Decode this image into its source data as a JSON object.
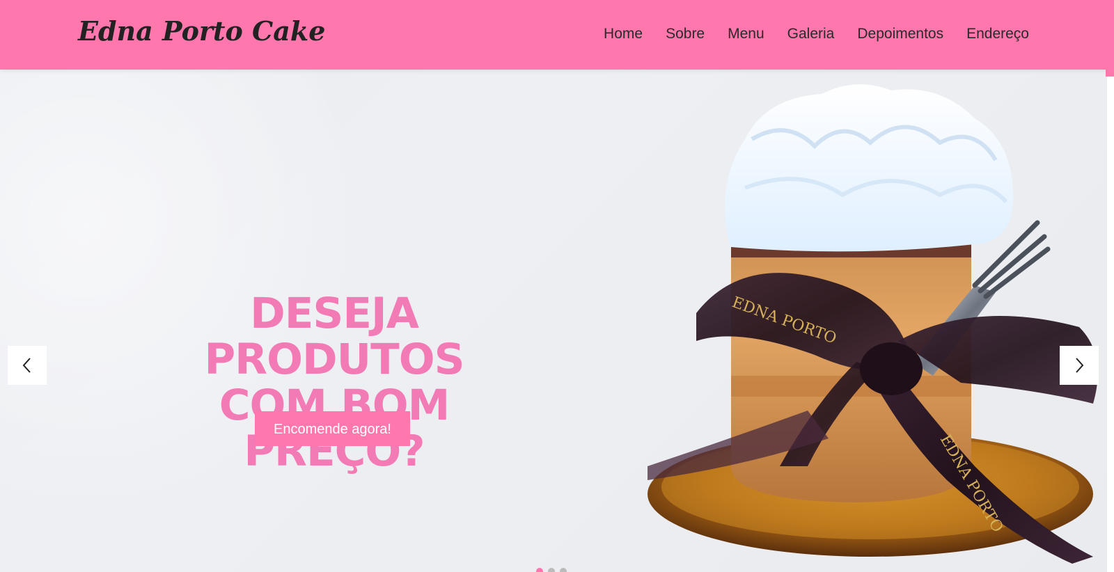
{
  "header": {
    "logo": "Edna Porto Cake",
    "nav": [
      "Home",
      "Sobre",
      "Menu",
      "Galeria",
      "Depoimentos",
      "Endereço"
    ]
  },
  "hero": {
    "title_line1": "DESEJA PRODUTOS",
    "title_line2": "COM BOM PREÇO?",
    "button_label": "Encomende agora!",
    "image_ribbon_text": "EDNA PORTO",
    "active_slide": 1,
    "slide_count": 3
  },
  "colors": {
    "brand_pink": "#ff77ad",
    "title_pink": "#f27bb5",
    "hero_bg": "#eceef2"
  },
  "icons": {
    "prev": "chevron-left-icon",
    "next": "chevron-right-icon"
  }
}
